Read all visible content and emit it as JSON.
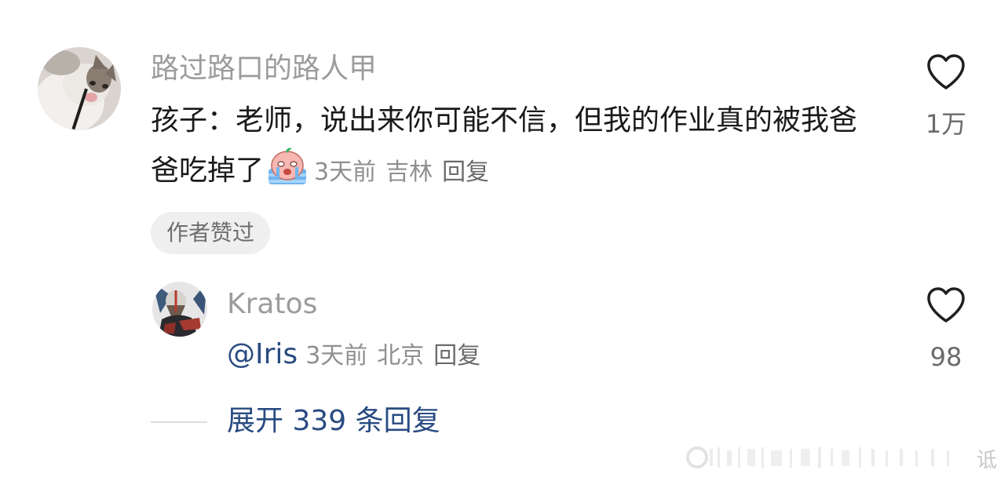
{
  "comment": {
    "username": "路过路口的路人甲",
    "text": "孩子：老师，说出来你可能不信，但我的作业真的被我爸爸吃掉了",
    "emoji_icon": "crying-emoji",
    "time": "3天前",
    "location": "吉林",
    "reply_label": "回复",
    "badge": "作者赞过",
    "likes": "1万"
  },
  "reply": {
    "username": "Kratos",
    "mention": "@Iris",
    "time": "3天前",
    "location": "北京",
    "reply_label": "回复",
    "likes": "98"
  },
  "expand": {
    "label": "展开 339 条回复"
  },
  "watermark": {
    "text": "诋"
  },
  "colors": {
    "username": "#9c9c9c",
    "text": "#1a1a1a",
    "meta": "#8f8f8f",
    "link_blue": "#294b82",
    "badge_bg": "#efefef"
  }
}
